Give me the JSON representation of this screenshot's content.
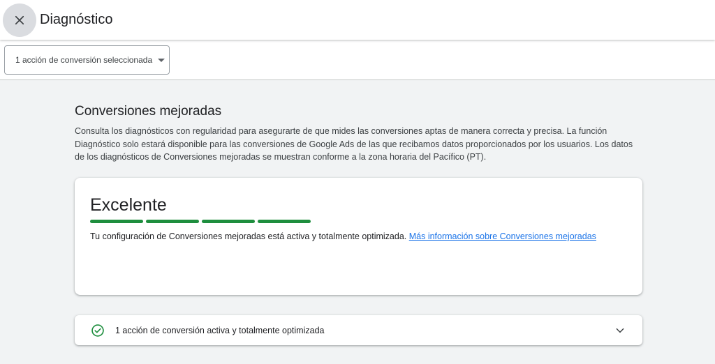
{
  "header": {
    "title": "Diagnóstico",
    "close_icon": "close-icon"
  },
  "filter": {
    "label": "1 acción de conversión seleccionada",
    "icon": "dropdown-arrow-icon"
  },
  "section": {
    "title": "Conversiones mejoradas",
    "description": "Consulta los diagnósticos con regularidad para asegurarte de que mides las conversiones aptas de manera correcta y precisa. La función Diagnóstico solo estará disponible para las conversiones de Google Ads de las que recibamos datos proporcionados por los usuarios. Los datos de los diagnósticos de Conversiones mejoradas se muestran conforme a la zona horaria del Pacífico (PT)."
  },
  "status_card": {
    "title": "Excelente",
    "level": "4 of 4",
    "bar_color": "#1e8e3e",
    "text": "Tu configuración de Conversiones mejoradas está activa y totalmente optimizada. ",
    "link": "Más información sobre Conversiones mejoradas"
  },
  "actions_panel": {
    "label": "1 acción de conversión activa y totalmente optimizada",
    "status_icon": "check-circle-icon",
    "status_color": "#1e8e3e",
    "expand_icon": "chevron-down-icon"
  }
}
